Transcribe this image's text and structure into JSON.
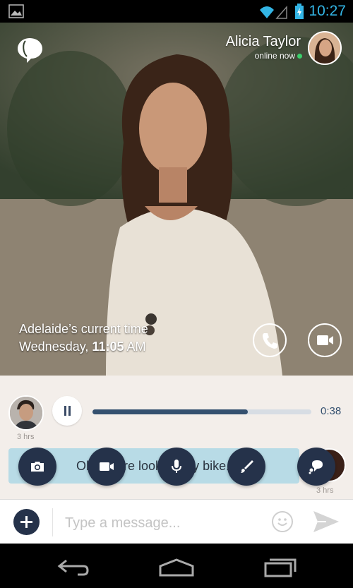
{
  "status_bar": {
    "time": "10:27",
    "icons": [
      "gallery-icon",
      "wifi-icon",
      "signal-icon",
      "battery-charging-icon"
    ]
  },
  "header": {
    "brand_icon": "chat-bubble-logo-icon",
    "contact_name": "Alicia Taylor",
    "contact_status": "online now",
    "status_color": "#3ad06b"
  },
  "location_time": {
    "label": "Adelaide’s current time",
    "day": "Wednesday,",
    "time": "11:05",
    "ampm": "AM"
  },
  "actions": {
    "call_icon": "phone-icon",
    "video_icon": "video-camera-icon"
  },
  "voice_message": {
    "ago": "3 hrs",
    "progress": 0.71,
    "duration": "0:38",
    "accent": "#34506f"
  },
  "text_message": {
    "text": "Oh, you’re looking my bike.",
    "ago": "3 hrs"
  },
  "attach_menu": [
    "camera-icon",
    "video-icon",
    "microphone-icon",
    "brush-icon",
    "sticker-bubble-icon"
  ],
  "composer": {
    "placeholder": "Type a message...",
    "brand_color": "#25324a"
  },
  "nav": [
    "back-icon",
    "home-icon",
    "recent-apps-icon"
  ]
}
